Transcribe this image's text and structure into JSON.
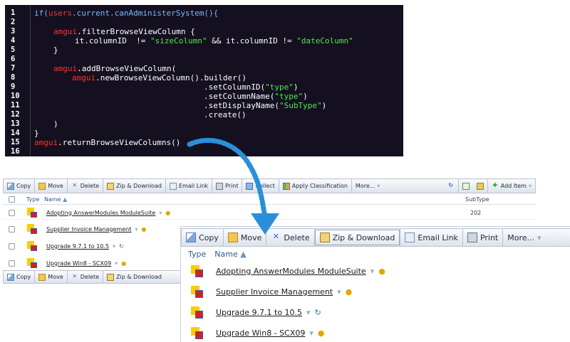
{
  "code": {
    "line_numbers": [
      "1",
      "2",
      "3",
      "4",
      "5",
      "6",
      "7",
      "8",
      "9",
      "10",
      "11",
      "12",
      "13",
      "14",
      "15",
      "16"
    ],
    "l1": {
      "kw_if": "if(",
      "users": "users",
      ".current.canAdministerSystem(){": ".current.canAdministerSystem(){"
    },
    "l3": {
      "amgui": "amgui",
      "rest": ".filterBrowseViewColumn {"
    },
    "l4": {
      "pre": "it.columnID  != ",
      "s1": "\"sizeColumn\"",
      "mid": " && it.columnID != ",
      "s2": "\"dateColumn\""
    },
    "l5": "}",
    "l7": {
      "amgui": "amgui",
      "rest": ".addBrowseViewColumn("
    },
    "l8": {
      "amgui": "amgui",
      "rest": ".newBrowseViewColumn().builder()"
    },
    "l9": {
      "pre": ".setColumnID(",
      "s": "\"type\"",
      "post": ")"
    },
    "l10": {
      "pre": ".setColumnName(",
      "s": "\"type\"",
      "post": ")"
    },
    "l11": {
      "pre": ".setDisplayName(",
      "s": "\"SubType\"",
      "post": ")"
    },
    "l12": ".create()",
    "l13": ")",
    "l14": "}",
    "l15": {
      "amgui": "amgui",
      "rest": ".returnBrowseViewColumns()"
    }
  },
  "toolbar": {
    "copy": "Copy",
    "move": "Move",
    "delete": "Delete",
    "zip": "Zip & Download",
    "email": "Email Link",
    "print": "Print",
    "collect": "Collect",
    "apply": "Apply Classification",
    "more": "More...",
    "add_item": "Add Item"
  },
  "columns": {
    "type": "Type",
    "name": "Name",
    "subtype": "SubType"
  },
  "rows": [
    {
      "name": "Adopting AnswerModules ModuleSuite",
      "subtype": "202"
    },
    {
      "name": "Supplier Invoice Management",
      "subtype": ""
    },
    {
      "name": "Upgrade 9.7.1 to 10.5",
      "subtype": ""
    },
    {
      "name": "Upgrade Win8 - SCX09",
      "subtype": ""
    }
  ],
  "colors": {
    "code_bg": "#14101f",
    "keyword": "#7ab8ff",
    "amgui": "#ff3030",
    "string": "#4de84d",
    "arrow": "#2a8fd8",
    "link": "#1a1a1a"
  },
  "icons": [
    "copy-icon",
    "move-icon",
    "delete-icon",
    "zip-icon",
    "email-icon",
    "print-icon",
    "collect-icon",
    "classification-icon",
    "refresh-icon",
    "new-icon",
    "folder-icon",
    "add-icon",
    "document-icon",
    "favorite-star-icon",
    "chevron-down-icon"
  ]
}
